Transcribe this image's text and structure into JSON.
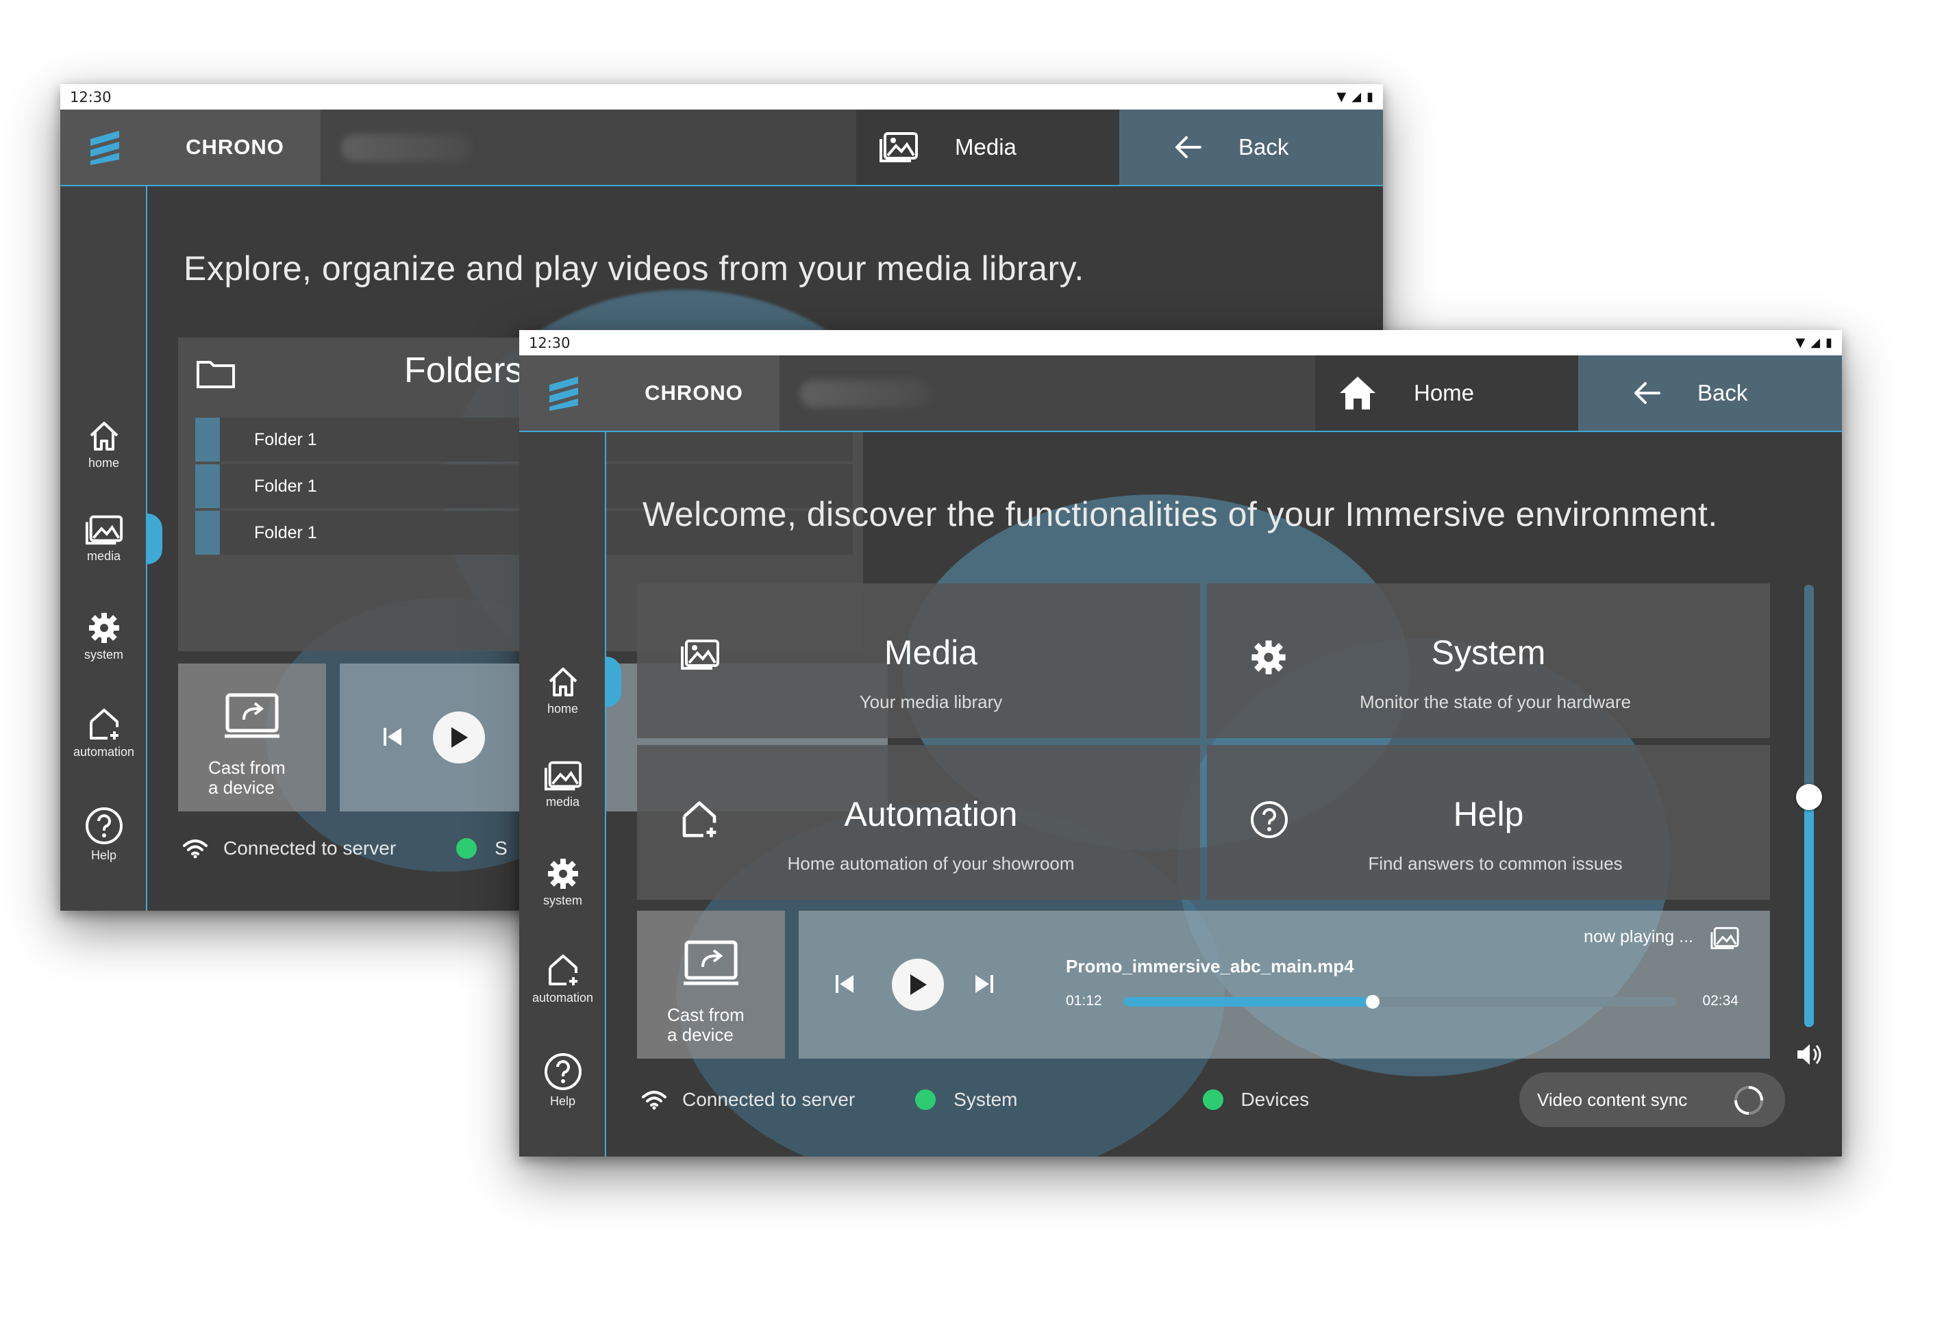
{
  "colors": {
    "accent": "#3fa9d6",
    "status_ok": "#2ecc71",
    "back_bg": "#4f6675"
  },
  "back_window": {
    "statusbar": {
      "time": "12:30"
    },
    "header": {
      "brand": "CHRONO",
      "nav_label": "Media",
      "back_label": "Back"
    },
    "sidebar": [
      {
        "label": "home",
        "icon": "home-icon"
      },
      {
        "label": "media",
        "icon": "media-icon"
      },
      {
        "label": "system",
        "icon": "gear-icon"
      },
      {
        "label": "automation",
        "icon": "automation-icon"
      },
      {
        "label": "Help",
        "icon": "help-icon"
      }
    ],
    "headline": "Explore, organize and play videos from your media library.",
    "folders": {
      "title": "Folders",
      "items": [
        "Folder 1",
        "Folder 1",
        "Folder 1"
      ]
    },
    "cast": {
      "line1": "Cast from",
      "line2": "a device"
    },
    "status": {
      "server": "Connected to server",
      "next_partial": "S"
    }
  },
  "front_window": {
    "statusbar": {
      "time": "12:30"
    },
    "header": {
      "brand": "CHRONO",
      "nav_label": "Home",
      "back_label": "Back"
    },
    "sidebar": [
      {
        "label": "home",
        "icon": "home-icon"
      },
      {
        "label": "media",
        "icon": "media-icon"
      },
      {
        "label": "system",
        "icon": "gear-icon"
      },
      {
        "label": "automation",
        "icon": "automation-icon"
      },
      {
        "label": "Help",
        "icon": "help-icon"
      }
    ],
    "headline": "Welcome, discover the functionalities of your Immersive environment.",
    "tiles": [
      {
        "title": "Media",
        "subtitle": "Your media library",
        "icon": "media-icon"
      },
      {
        "title": "System",
        "subtitle": "Monitor the state of your hardware",
        "icon": "gear-icon"
      },
      {
        "title": "Automation",
        "subtitle": "Home automation of your showroom",
        "icon": "automation-icon"
      },
      {
        "title": "Help",
        "subtitle": "Find answers to common issues",
        "icon": "help-icon"
      }
    ],
    "cast": {
      "line1": "Cast from",
      "line2": "a device"
    },
    "player": {
      "now_playing": "now playing ...",
      "filename": "Promo_immersive_abc_main.mp4",
      "elapsed": "01:12",
      "duration": "02:34",
      "progress": 0.45
    },
    "volume": {
      "level": 0.52
    },
    "status": {
      "server": "Connected to server",
      "system": "System",
      "devices": "Devices",
      "sync": "Video content sync"
    }
  }
}
